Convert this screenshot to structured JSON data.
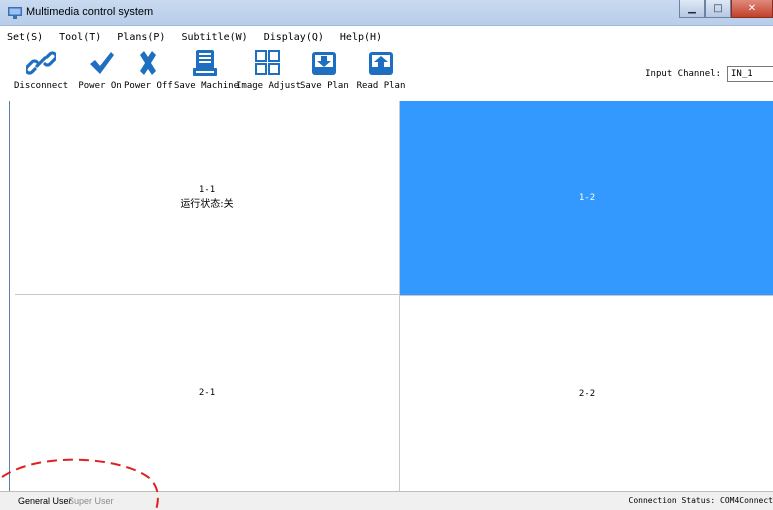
{
  "window": {
    "title": "Multimedia control system"
  },
  "menu": [
    {
      "label": "Set(S)"
    },
    {
      "label": "Tool(T)"
    },
    {
      "label": "Plans(P)"
    },
    {
      "label": "Subtitle(W)"
    },
    {
      "label": "Display(Q)"
    },
    {
      "label": "Help(H)"
    }
  ],
  "toolbar": [
    {
      "label": "Disconnect",
      "icon": "link-icon"
    },
    {
      "label": "Power On",
      "icon": "checkmark-icon"
    },
    {
      "label": "Power Off",
      "icon": "x-icon"
    },
    {
      "label": "Save Machine",
      "icon": "save-machine-icon"
    },
    {
      "label": "Image Adjust",
      "icon": "grid-icon"
    },
    {
      "label": "Save Plan",
      "icon": "download-box-icon"
    },
    {
      "label": "Read Plan",
      "icon": "upload-box-icon"
    }
  ],
  "input_channel": {
    "label": "Input Channel:",
    "value": "IN_1"
  },
  "grid": {
    "cells": [
      {
        "id": "1-1",
        "status": "运行状态:关",
        "selected": false
      },
      {
        "id": "1-2",
        "status": "",
        "selected": true
      },
      {
        "id": "2-1",
        "status": "",
        "selected": false
      },
      {
        "id": "2-2",
        "status": "",
        "selected": false
      }
    ]
  },
  "statusbar": {
    "user_general": "General User",
    "user_super": "Super User",
    "connection": "Connection Status:  COM4Connect"
  },
  "colors": {
    "selected_cell": "#3399ff",
    "icon_blue": "#1f6fc0",
    "annotation_red": "#e02020"
  }
}
